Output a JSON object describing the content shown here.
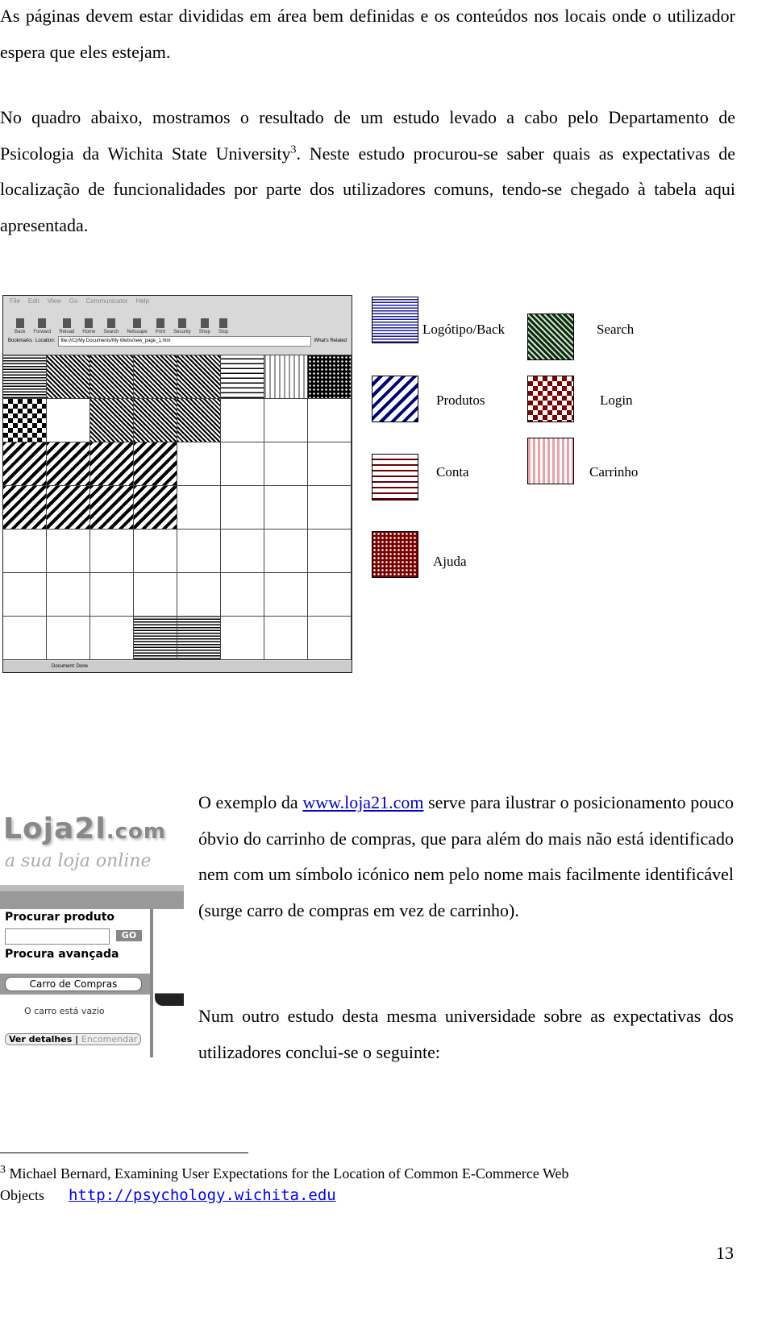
{
  "paragraphs": {
    "p1": "As páginas devem estar divididas em área bem definidas e os conteúdos nos locais onde o utilizador espera que eles estejam.",
    "p2a": "No quadro abaixo, mostramos o resultado de um estudo levado a cabo pelo Departamento de Psicologia da Wichita State University",
    "p2_ref": "3",
    "p2b": ". Neste estudo procurou-se saber quais as expectativas de localização de funcionalidades por parte dos utilizadores comuns, tendo-se chegado à tabela aqui apresentada.",
    "p3a": "O exemplo da ",
    "p3_link": "www.loja21.com",
    "p3b": " serve para ilustrar o posicionamento pouco óbvio do carrinho de compras, que para além do mais não está identificado nem com um símbolo icónico nem pelo nome mais facilmente identificável (surge carro de compras em vez de carrinho).",
    "p4": "Num outro estudo desta mesma universidade sobre as expectativas dos utilizadores conclui-se o seguinte:"
  },
  "browser": {
    "menu": [
      "File",
      "Edit",
      "View",
      "Go",
      "Communicator",
      "Help"
    ],
    "tools": [
      "Back",
      "Forward",
      "Reload",
      "Home",
      "Search",
      "Netscape",
      "Print",
      "Security",
      "Shop",
      "Stop"
    ],
    "bookmarks": "Bookmarks",
    "location_label": "Location:",
    "location": "file:///C|/My Documents/My Webs/new_page_1.htm",
    "whats_related": "What's Related",
    "status": "Document: Done",
    "grid": [
      [
        "logo",
        "search",
        "search",
        "search",
        "search",
        "conta",
        "carr",
        "ajuda"
      ],
      [
        "login",
        "",
        "search",
        "search",
        "search",
        "",
        "",
        ""
      ],
      [
        "prod",
        "prod",
        "prod",
        "prod",
        "",
        "",
        "",
        ""
      ],
      [
        "prod",
        "prod",
        "prod",
        "prod",
        "",
        "",
        "",
        ""
      ],
      [
        "",
        "",
        "",
        "",
        "",
        "",
        "",
        ""
      ],
      [
        "",
        "",
        "",
        "",
        "",
        "",
        "",
        ""
      ],
      [
        "",
        "",
        "",
        "logo",
        "logo",
        "",
        "",
        ""
      ]
    ]
  },
  "legend": [
    {
      "key": "logo",
      "label": "Logótipo/Back",
      "color": "#1a1aa0"
    },
    {
      "key": "search",
      "label": "Search",
      "color": "#0f2a0f"
    },
    {
      "key": "prod",
      "label": "Produtos",
      "color": "#00007a"
    },
    {
      "key": "login",
      "label": "Login",
      "color": "#7a0000"
    },
    {
      "key": "conta",
      "label": "Conta",
      "color": "#6a0000"
    },
    {
      "key": "carr",
      "label": "Carrinho",
      "color": "#eea0a8"
    },
    {
      "key": "ajuda",
      "label": "Ajuda",
      "color": "#7a0000"
    }
  ],
  "loja": {
    "logo": "Loja21.com",
    "tagline": "a sua loja online",
    "search_label": "Procurar produto",
    "go": "GO",
    "advanced": "Procura avançada",
    "cart_button": "Carro de Compras",
    "cart_empty": "O carro está vazio",
    "details": "Ver detalhes",
    "order": "Encomendar"
  },
  "footnote": {
    "num": "3",
    "text": " Michael Bernard,  Examining User Expectations for the Location of Common E-Commerce Web Objects",
    "link": "http://psychology.wichita.edu"
  },
  "page_number": "13"
}
